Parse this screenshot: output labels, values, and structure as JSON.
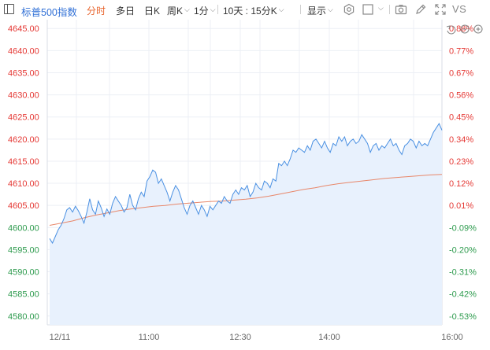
{
  "toolbar": {
    "symbol": "标普500指数",
    "tabs": {
      "fenshi": "分时",
      "duori": "多日",
      "rik": "日K",
      "zhouk": "周K",
      "minute": "1分",
      "period": "10天 : 15分K",
      "display": "显示"
    },
    "vs_label": "VS",
    "accent_color": "#e8632b",
    "symbol_color": "#2f6fd6"
  },
  "icons": {
    "sidebar": "sidebar-toggle-icon",
    "settings": "gear-icon",
    "layout": "square-icon",
    "snapshot": "camera-icon",
    "draw": "pencil-icon",
    "fullscreen": "expand-icon",
    "reset": "undo-icon",
    "zoom_out": "zoom-out-icon",
    "zoom_in": "zoom-in-icon"
  },
  "chart_data": {
    "type": "area",
    "x_ticks": [
      "12/11",
      "11:00",
      "12:30",
      "14:00",
      "16:00"
    ],
    "y_left_ticks": [
      "4645.00",
      "4640.00",
      "4635.00",
      "4630.00",
      "4625.00",
      "4620.00",
      "4615.00",
      "4610.00",
      "4605.00",
      "4600.00",
      "4595.00",
      "4590.00",
      "4585.00",
      "4580.00"
    ],
    "y_right_ticks": [
      "0.88%",
      "0.77%",
      "0.67%",
      "0.56%",
      "0.45%",
      "0.34%",
      "0.23%",
      "0.12%",
      "0.01%",
      "-0.09%",
      "-0.20%",
      "-0.31%",
      "-0.42%",
      "-0.53%"
    ],
    "ylim": [
      4578,
      4647
    ],
    "baseline": 4604.5,
    "series": [
      {
        "values": [
          4597.5,
          4596.5,
          4598.0,
          4599.5,
          4600.5,
          4602.0,
          4604.0,
          4604.5,
          4603.5,
          4604.8,
          4603.8,
          4602.5,
          4601.0,
          4603.5,
          4606.5,
          4604.0,
          4603.0,
          4606.0,
          4604.5,
          4602.5,
          4604.2,
          4603.0,
          4605.5,
          4607.0,
          4606.0,
          4605.0,
          4603.5,
          4604.5,
          4607.5,
          4605.0,
          4604.0,
          4606.5,
          4608.0,
          4607.0,
          4610.5,
          4611.5,
          4613.0,
          4612.5,
          4610.0,
          4611.0,
          4609.5,
          4608.0,
          4606.0,
          4608.0,
          4609.5,
          4608.5,
          4606.5,
          4604.5,
          4603.0,
          4605.0,
          4606.0,
          4604.5,
          4603.0,
          4605.0,
          4604.0,
          4602.5,
          4604.8,
          4604.0,
          4605.0,
          4606.0,
          4605.5,
          4607.0,
          4606.0,
          4605.5,
          4607.5,
          4608.5,
          4607.5,
          4609.0,
          4608.5,
          4609.5,
          4607.0,
          4608.0,
          4610.0,
          4609.0,
          4608.5,
          4610.5,
          4610.0,
          4609.0,
          4611.0,
          4610.5,
          4614.5,
          4614.0,
          4615.0,
          4614.0,
          4615.5,
          4617.5,
          4617.0,
          4618.0,
          4617.5,
          4617.0,
          4618.5,
          4617.5,
          4619.5,
          4620.0,
          4619.0,
          4618.0,
          4619.5,
          4618.0,
          4617.0,
          4619.0,
          4618.5,
          4620.5,
          4619.5,
          4620.5,
          4618.5,
          4619.5,
          4620.0,
          4619.0,
          4619.5,
          4621.0,
          4620.0,
          4619.0,
          4617.0,
          4618.5,
          4619.0,
          4617.5,
          4618.5,
          4618.0,
          4619.0,
          4620.0,
          4618.5,
          4619.0,
          4617.5,
          4616.5,
          4618.5,
          4619.0,
          4620.0,
          4619.5,
          4618.0,
          4619.5,
          4618.5,
          4619.0,
          4618.5,
          4620.0,
          4621.5,
          4622.5,
          4623.5,
          4622.0
        ]
      },
      {
        "values": [
          4600.5,
          4601.0,
          4601.5,
          4602.2,
          4602.8,
          4603.3,
          4603.8,
          4604.2,
          4604.5,
          4604.8,
          4605.0,
          4605.3,
          4605.5,
          4605.7,
          4605.9,
          4606.0,
          4606.2,
          4606.4,
          4606.7,
          4607.1,
          4607.6,
          4608.1,
          4608.6,
          4609.0,
          4609.5,
          4609.9,
          4610.2,
          4610.5,
          4610.8,
          4611.1,
          4611.3,
          4611.5,
          4611.7,
          4611.9,
          4612.0
        ]
      }
    ],
    "colors": {
      "price_line": "#4a90e2",
      "price_fill": "#e8f1fd",
      "avg_line": "#e8876a",
      "up": "#e53935",
      "down": "#2e9b4e",
      "grid": "#eceff5"
    }
  }
}
